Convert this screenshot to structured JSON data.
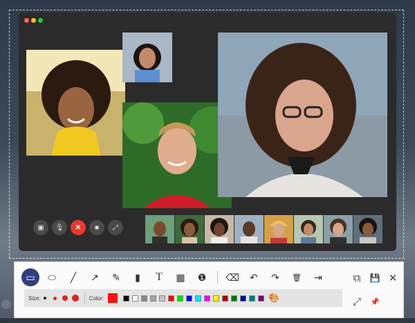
{
  "window": {
    "traffic_lights": [
      "close",
      "minimize",
      "zoom"
    ]
  },
  "call": {
    "participants_main": [
      "participant-afro-woman",
      "participant-top-woman",
      "participant-smiling-man",
      "participant-glasses-woman"
    ],
    "thumbnail_count": 8,
    "controls": [
      {
        "name": "sidebar-button",
        "icon": "sidebar-icon"
      },
      {
        "name": "mute-button",
        "icon": "microphone-icon"
      },
      {
        "name": "end-call-button",
        "icon": "close-icon"
      },
      {
        "name": "camera-button",
        "icon": "camera-icon"
      },
      {
        "name": "fullscreen-button",
        "icon": "fullscreen-icon"
      }
    ]
  },
  "toolbar": {
    "tools": [
      {
        "name": "rectangle-tool",
        "icon": "rectangle-icon",
        "glyph": "▭",
        "active": true
      },
      {
        "name": "ellipse-tool",
        "icon": "ellipse-icon",
        "glyph": "⬭"
      },
      {
        "name": "line-tool",
        "icon": "line-icon",
        "glyph": "╱"
      },
      {
        "name": "arrow-tool",
        "icon": "arrow-icon",
        "glyph": "↗"
      },
      {
        "name": "pencil-tool",
        "icon": "pencil-icon",
        "glyph": "✎"
      },
      {
        "name": "highlighter-tool",
        "icon": "highlighter-icon",
        "glyph": "▮"
      },
      {
        "name": "text-tool",
        "icon": "text-icon",
        "glyph": "T"
      },
      {
        "name": "mosaic-tool",
        "icon": "mosaic-icon",
        "glyph": "▦"
      },
      {
        "name": "callout-tool",
        "icon": "callout-icon",
        "glyph": "❶"
      }
    ],
    "edit_tools": [
      {
        "name": "eraser-tool",
        "icon": "eraser-icon",
        "glyph": "⌫"
      },
      {
        "name": "undo-button",
        "icon": "undo-icon",
        "glyph": "↶"
      },
      {
        "name": "redo-button",
        "icon": "redo-icon",
        "glyph": "↷"
      },
      {
        "name": "delete-button",
        "icon": "trash-icon",
        "glyph": "🗑"
      },
      {
        "name": "exit-button",
        "icon": "exit-icon",
        "glyph": "⇥"
      }
    ],
    "size_label": "Size:",
    "color_label": "Color:",
    "current_color": "#ff1010",
    "swatches": [
      "#000000",
      "#ffffff",
      "#888888",
      "#a0a0a0",
      "#c4c4c4",
      "#ff0000",
      "#00e000",
      "#0000ff",
      "#00e5ff",
      "#ff00ff",
      "#ffff00",
      "#aa0000",
      "#007a00",
      "#000099",
      "#007a7a",
      "#7a007a"
    ],
    "right_actions": [
      {
        "name": "copy-button",
        "icon": "copy-icon",
        "glyph": "⧉"
      },
      {
        "name": "save-button",
        "icon": "save-icon",
        "glyph": "💾"
      },
      {
        "name": "close-button",
        "icon": "close-icon",
        "glyph": "✕"
      },
      {
        "name": "expand-button",
        "icon": "expand-icon",
        "glyph": "⤢"
      },
      {
        "name": "pin-button",
        "icon": "pin-icon",
        "glyph": "📌"
      }
    ]
  }
}
